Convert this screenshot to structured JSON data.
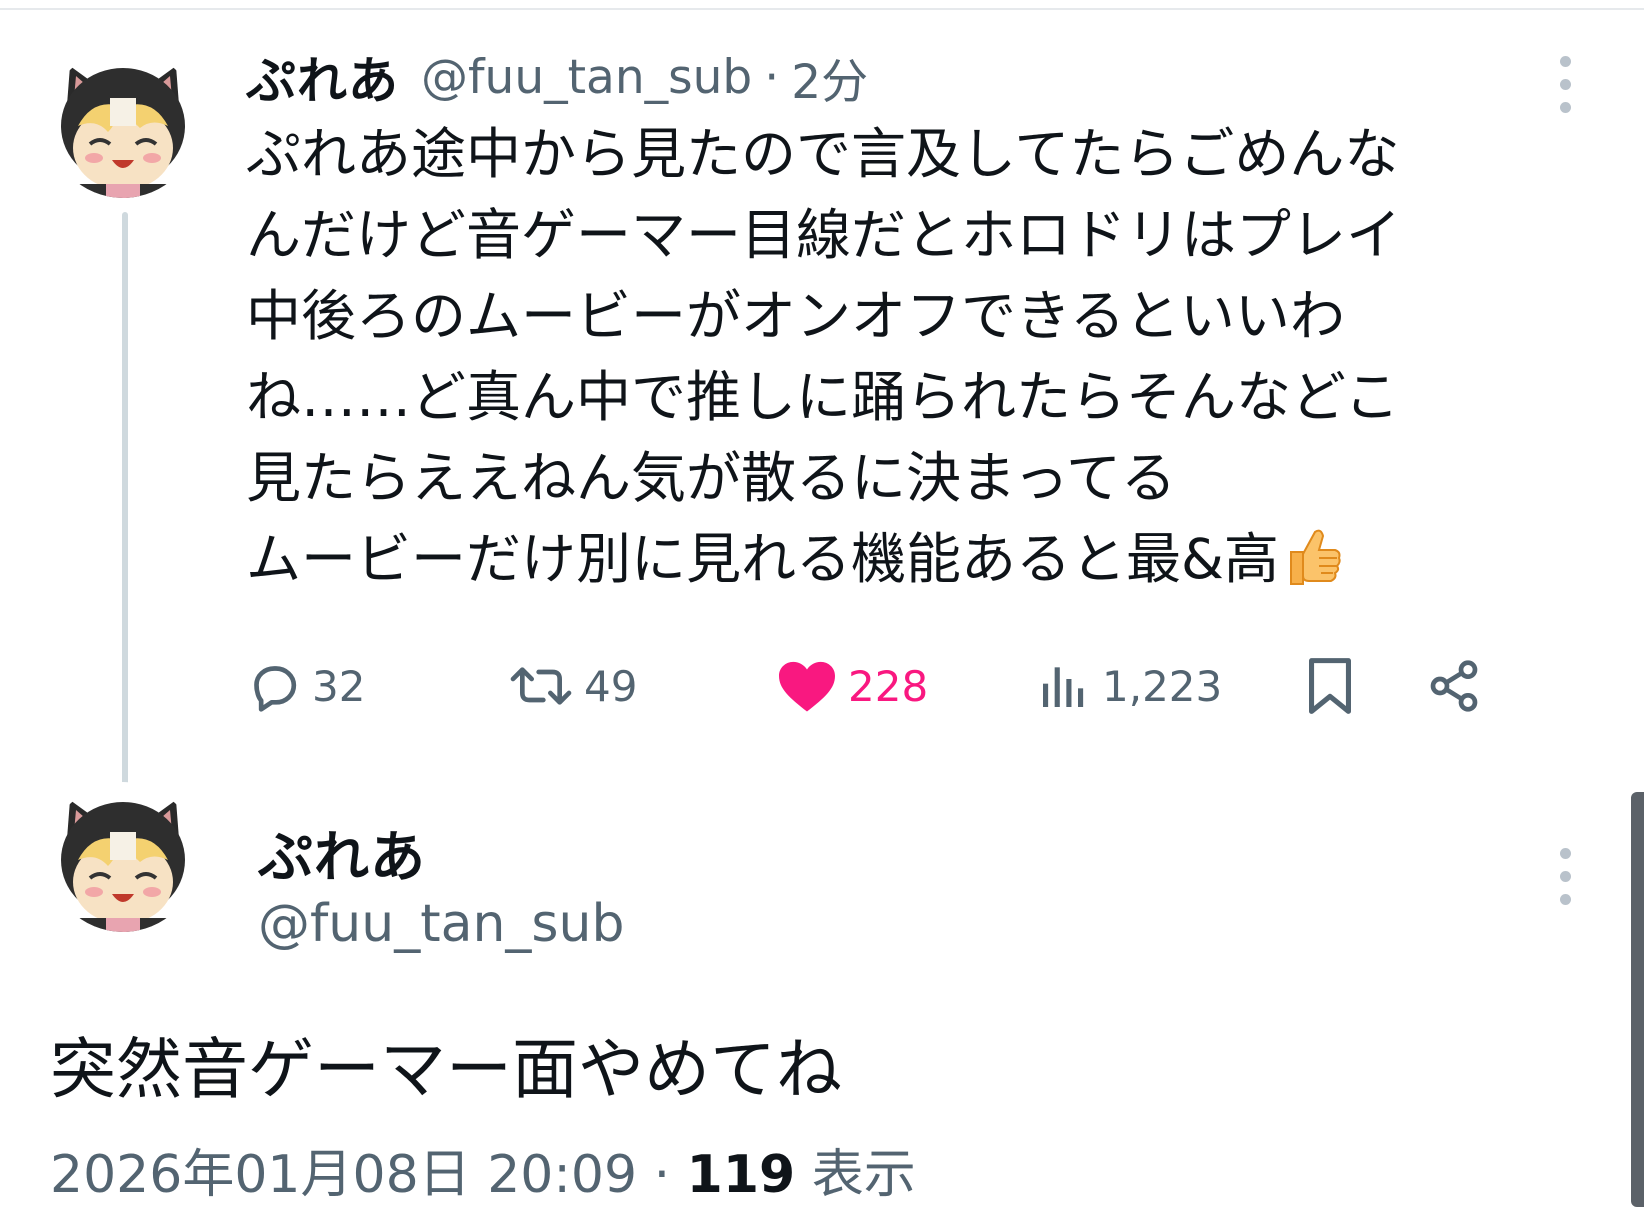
{
  "reply_tweet": {
    "display_name": "ぷれあ",
    "handle": "@fuu_tan_sub",
    "separator": "·",
    "time_ago": "2分",
    "avatar_icon": "cat-hood-girl-avatar-icon",
    "body_lines": [
      "ぷれあ途中から見たので言及してたらごめんな",
      "んだけど音ゲーマー目線だとホロドリはプレイ",
      "中後ろのムービーがオンオフできるといいわ",
      "ね……ど真ん中で推しに踊られたらそんなどこ",
      "見たらええねん気が散るに決まってる",
      "ムービーだけ別に見れる機能あると最&高"
    ],
    "body_emoji": "thumbs-up",
    "actions": {
      "reply_count": "32",
      "retweet_count": "49",
      "like_count": "228",
      "views_count": "1,223"
    },
    "like_color": "#f91880"
  },
  "main_tweet": {
    "display_name": "ぷれあ",
    "handle": "@fuu_tan_sub",
    "text": "突然音ゲーマー面やめてね",
    "timestamp": "2026年01月08日 20:09",
    "separator": "·",
    "views_count": "119",
    "views_label": "表示"
  },
  "colors": {
    "text_primary": "#0f1419",
    "text_secondary": "#536471",
    "thread_line": "#cfd9de"
  }
}
